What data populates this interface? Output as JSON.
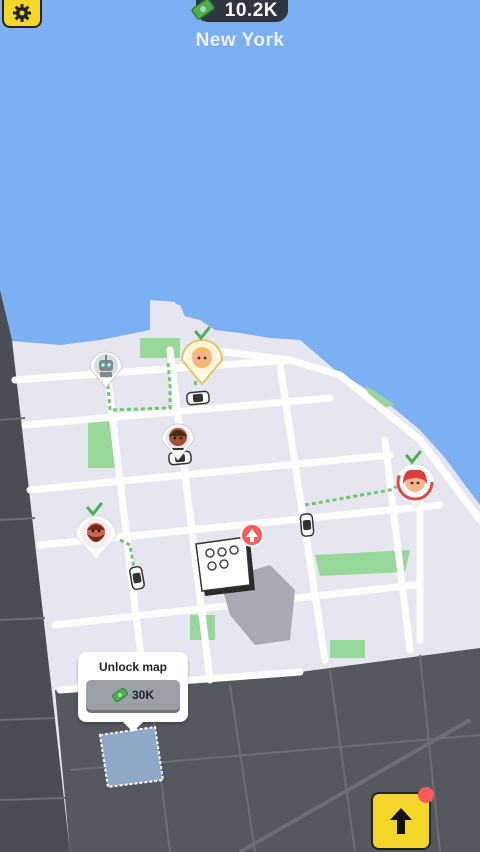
{
  "hud": {
    "money": "10.2K",
    "city": "New York",
    "settings_icon": "gear-icon",
    "money_icon": "cash-icon"
  },
  "unlock": {
    "title": "Unlock map",
    "price": "30K",
    "price_icon": "cash-icon"
  },
  "upgrade": {
    "icon": "arrow-up-icon",
    "has_notification": true
  },
  "colors": {
    "water": "#7db0f2",
    "land": "#e6e6f0",
    "road": "#ffffff",
    "park": "#97d89a",
    "locked_area": "#4f5258",
    "accent_yellow": "#f4d629",
    "route": "#6cc870",
    "check": "#4caf50",
    "alert": "#ff5b5b"
  },
  "markers": [
    {
      "name": "robot-passenger-marker",
      "state": "done"
    },
    {
      "name": "blonde-passenger-marker",
      "state": "done"
    },
    {
      "name": "bald-passenger-marker",
      "state": "waiting"
    },
    {
      "name": "redhair-passenger-marker",
      "state": "done"
    },
    {
      "name": "bearded-passenger-marker",
      "state": "done"
    },
    {
      "name": "building-upgrade-marker",
      "state": "upgrade"
    }
  ]
}
